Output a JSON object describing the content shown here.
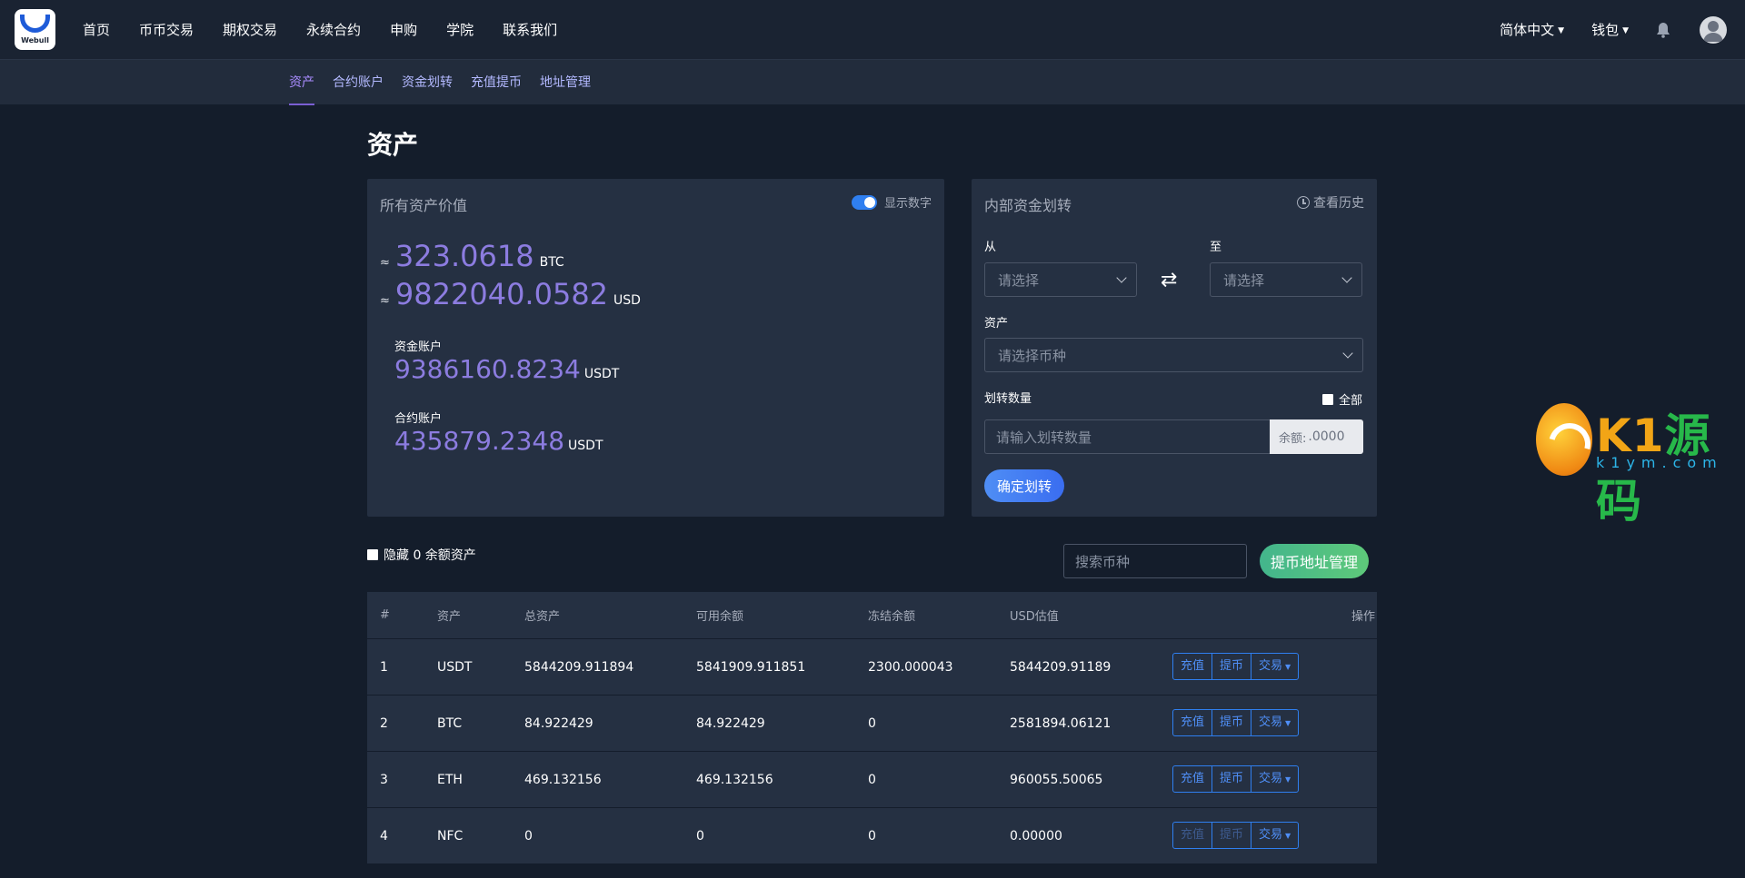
{
  "logo": {
    "wordmark": "Webull"
  },
  "nav": {
    "items": [
      "首页",
      "币币交易",
      "期权交易",
      "永续合约",
      "申购",
      "学院",
      "联系我们"
    ]
  },
  "top_right": {
    "language": "简体中文",
    "wallet": "钱包"
  },
  "subnav": {
    "items": [
      "资产",
      "合约账户",
      "资金划转",
      "充值提币",
      "地址管理"
    ],
    "active_index": 0
  },
  "page_title": "资产",
  "assets_card": {
    "title": "所有资产价值",
    "toggle_label": "显示数字",
    "toggle_on": true,
    "approx": "≈",
    "btc_value": "323.0618",
    "btc_unit": "BTC",
    "usd_value": "9822040.0582",
    "usd_unit": "USD",
    "fund_label": "资金账户",
    "fund_value": "9386160.8234",
    "fund_unit": "USDT",
    "contract_label": "合约账户",
    "contract_value": "435879.2348",
    "contract_unit": "USDT"
  },
  "transfer_card": {
    "title": "内部资金划转",
    "history": "查看历史",
    "from_label": "从",
    "to_label": "至",
    "from_placeholder": "请选择",
    "to_placeholder": "请选择",
    "asset_label": "资产",
    "asset_placeholder": "请选择币种",
    "amount_label": "划转数量",
    "all_label": "全部",
    "amount_placeholder": "请输入划转数量",
    "balance_label": "余额:",
    "balance_value": ".0000",
    "confirm": "确定划转"
  },
  "controls": {
    "hide_zero": "隐藏 0 余额资产",
    "search_placeholder": "搜索币种",
    "address_button": "提币地址管理"
  },
  "table": {
    "headers": [
      "#",
      "资产",
      "总资产",
      "可用余额",
      "冻结余额",
      "USD估值",
      "操作"
    ],
    "actions": [
      "充值",
      "提币",
      "交易"
    ],
    "rows": [
      {
        "index": "1",
        "asset": "USDT",
        "total": "5844209.911894",
        "available": "5841909.911851",
        "frozen": "2300.000043",
        "usd": "5844209.91189"
      },
      {
        "index": "2",
        "asset": "BTC",
        "total": "84.922429",
        "available": "84.922429",
        "frozen": "0",
        "usd": "2581894.06121"
      },
      {
        "index": "3",
        "asset": "ETH",
        "total": "469.132156",
        "available": "469.132156",
        "frozen": "0",
        "usd": "960055.50065"
      },
      {
        "index": "4",
        "asset": "NFC",
        "total": "0",
        "available": "0",
        "frozen": "0",
        "usd": "0.00000"
      }
    ]
  },
  "watermark": {
    "brand_k1": "K1",
    "brand_cn": "源码",
    "domain": "k1ym.com"
  },
  "colors": {
    "accent_purple": "#8c7ce0",
    "accent_blue": "#2f7ff0",
    "green": "#43b58c",
    "bg": "#141d2b",
    "card": "#253042"
  }
}
